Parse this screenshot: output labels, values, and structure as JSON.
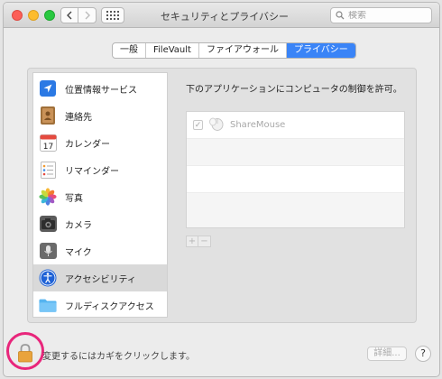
{
  "window": {
    "title": "セキュリティとプライバシー"
  },
  "search": {
    "placeholder": "検索"
  },
  "tabs": [
    {
      "label": "一般",
      "active": false
    },
    {
      "label": "FileVault",
      "active": false
    },
    {
      "label": "ファイアウォール",
      "active": false
    },
    {
      "label": "プライバシー",
      "active": true
    }
  ],
  "sidebar": {
    "items": [
      {
        "label": "位置情報サービス",
        "icon": "location-arrow-icon"
      },
      {
        "label": "連絡先",
        "icon": "contacts-book-icon"
      },
      {
        "label": "カレンダー",
        "icon": "calendar-icon",
        "calendar_day": "17"
      },
      {
        "label": "リマインダー",
        "icon": "reminders-icon"
      },
      {
        "label": "写真",
        "icon": "photos-icon"
      },
      {
        "label": "カメラ",
        "icon": "camera-icon"
      },
      {
        "label": "マイク",
        "icon": "microphone-icon"
      },
      {
        "label": "アクセシビリティ",
        "icon": "accessibility-icon",
        "selected": true
      },
      {
        "label": "フルディスクアクセス",
        "icon": "folder-icon"
      }
    ]
  },
  "pane": {
    "title": "下のアプリケーションにコンピュータの制御を許可。",
    "apps": [
      {
        "name": "ShareMouse",
        "checked": true,
        "check_glyph": "✓"
      }
    ],
    "add_label": "+",
    "remove_label": "−"
  },
  "footer": {
    "lock_text": "変更するにはカギをクリックします。",
    "details_label": "詳細...",
    "help_label": "?"
  },
  "colors": {
    "accent": "#3a84f7",
    "highlight_circle": "#e8267b"
  }
}
